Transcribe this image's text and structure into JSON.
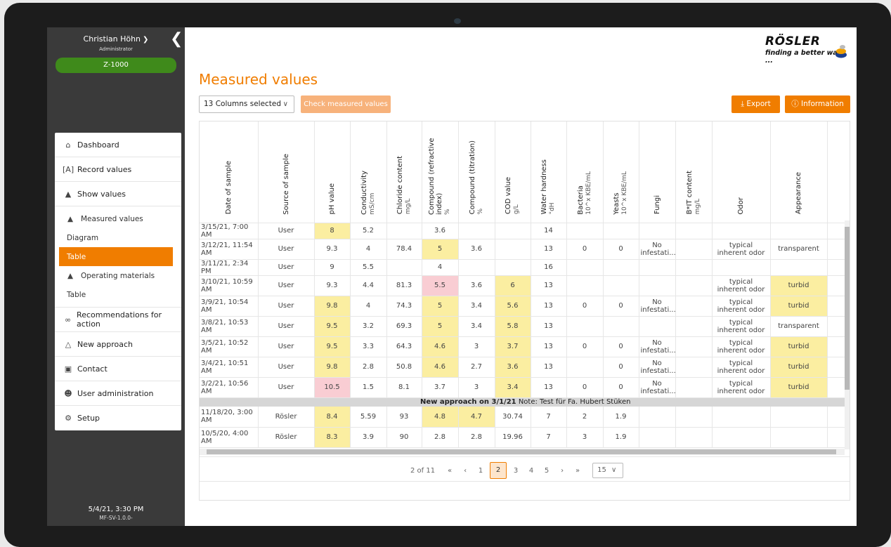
{
  "sidebar": {
    "user_name": "Christian Höhn",
    "user_role": "Administrator",
    "machine": "Z-1000",
    "nav": {
      "dashboard": "Dashboard",
      "record_values": "Record values",
      "show_values": "Show values",
      "measured_values": "Measured values",
      "diagram": "Diagram",
      "table_1": "Table",
      "operating_materials": "Operating materials",
      "table_2": "Table",
      "recommendations": "Recommendations for action",
      "new_approach": "New approach",
      "contact": "Contact",
      "user_admin": "User administration",
      "setup": "Setup"
    },
    "footer_date": "5/4/21, 3:30 PM",
    "footer_version": "MF-SV-1.0.0-"
  },
  "logo": {
    "word": "RÖSLER",
    "tagline": "finding a better way ..."
  },
  "main": {
    "title": "Measured values",
    "columns_selected": "13 Columns selected",
    "check_button": "Check measured values",
    "export_button": "Export",
    "info_button": "Information"
  },
  "table": {
    "headers": [
      {
        "label": "Date of sample",
        "unit": ""
      },
      {
        "label": "Source of sample",
        "unit": ""
      },
      {
        "label": "pH value",
        "unit": ""
      },
      {
        "label": "Conductivity",
        "unit": "mS/cm"
      },
      {
        "label": "Chloride content",
        "unit": "mg/L"
      },
      {
        "label": "Compound (refractive index)",
        "unit": "%"
      },
      {
        "label": "Compound (titration)",
        "unit": "%"
      },
      {
        "label": "COD value",
        "unit": "g/L"
      },
      {
        "label": "Water hardness",
        "unit": "°dH"
      },
      {
        "label": "Bacteria",
        "unit": "10^x KBE/mL"
      },
      {
        "label": "Yeasts",
        "unit": "10^x KBE/mL"
      },
      {
        "label": "Fungi",
        "unit": ""
      },
      {
        "label": "B*IT content",
        "unit": "mg/L"
      },
      {
        "label": "Odor",
        "unit": ""
      },
      {
        "label": "Appearance",
        "unit": ""
      }
    ],
    "rows": [
      [
        "3/15/21, 7:00 AM",
        "User",
        "8",
        "5.2",
        "",
        "3.6",
        "",
        "",
        "14",
        "",
        "",
        "",
        "",
        "",
        ""
      ],
      [
        "3/12/21, 11:54 AM",
        "User",
        "9.3",
        "4",
        "78.4",
        "5",
        "3.6",
        "",
        "13",
        "0",
        "0",
        "No infestati...",
        "",
        "typical inherent odor",
        "transparent"
      ],
      [
        "3/11/21, 2:34 PM",
        "User",
        "9",
        "5.5",
        "",
        "4",
        "",
        "",
        "16",
        "",
        "",
        "",
        "",
        "",
        ""
      ],
      [
        "3/10/21, 10:59 AM",
        "User",
        "9.3",
        "4.4",
        "81.3",
        "5.5",
        "3.6",
        "6",
        "13",
        "",
        "",
        "",
        "",
        "typical inherent odor",
        "turbid"
      ],
      [
        "3/9/21, 10:54 AM",
        "User",
        "9.8",
        "4",
        "74.3",
        "5",
        "3.4",
        "5.6",
        "13",
        "0",
        "0",
        "No infestati...",
        "",
        "typical inherent odor",
        "turbid"
      ],
      [
        "3/8/21, 10:53 AM",
        "User",
        "9.5",
        "3.2",
        "69.3",
        "5",
        "3.4",
        "5.8",
        "13",
        "",
        "",
        "",
        "",
        "typical inherent odor",
        "transparent"
      ],
      [
        "3/5/21, 10:52 AM",
        "User",
        "9.5",
        "3.3",
        "64.3",
        "4.6",
        "3",
        "3.7",
        "13",
        "0",
        "0",
        "No infestati...",
        "",
        "typical inherent odor",
        "turbid"
      ],
      [
        "3/4/21, 10:51 AM",
        "User",
        "9.8",
        "2.8",
        "50.8",
        "4.6",
        "2.7",
        "3.6",
        "13",
        "",
        "0",
        "No infestati...",
        "",
        "typical inherent odor",
        "turbid"
      ],
      [
        "3/2/21, 10:56 AM",
        "User",
        "10.5",
        "1.5",
        "8.1",
        "3.7",
        "3",
        "3.4",
        "13",
        "0",
        "0",
        "No infestati...",
        "",
        "typical inherent odor",
        "turbid"
      ]
    ],
    "group_label": "New approach on 3/1/21",
    "group_note": "Note: Test für Fa. Hubert Stüken",
    "rows_after": [
      [
        "11/18/20, 3:00 AM",
        "Rösler",
        "8.4",
        "5.59",
        "93",
        "4.8",
        "4.7",
        "30.74",
        "7",
        "2",
        "1.9",
        "",
        "",
        "",
        ""
      ],
      [
        "10/5/20, 4:00 AM",
        "Rösler",
        "8.3",
        "3.9",
        "90",
        "2.8",
        "2.8",
        "19.96",
        "7",
        "3",
        "1.9",
        "",
        "",
        "",
        ""
      ]
    ],
    "highlight_colors": {
      "warning": "#fbeea1",
      "critical": "#f9cdd3"
    }
  },
  "pager": {
    "status": "2 of 11",
    "first": "«",
    "prev": "‹",
    "pages": [
      "1",
      "2",
      "3",
      "4",
      "5"
    ],
    "current": "2",
    "next": "›",
    "last": "»",
    "page_size": "15"
  },
  "colors": {
    "accent": "#f07d00",
    "sidebar": "#3a3a3a",
    "machine_badge": "#3f8a1b"
  }
}
